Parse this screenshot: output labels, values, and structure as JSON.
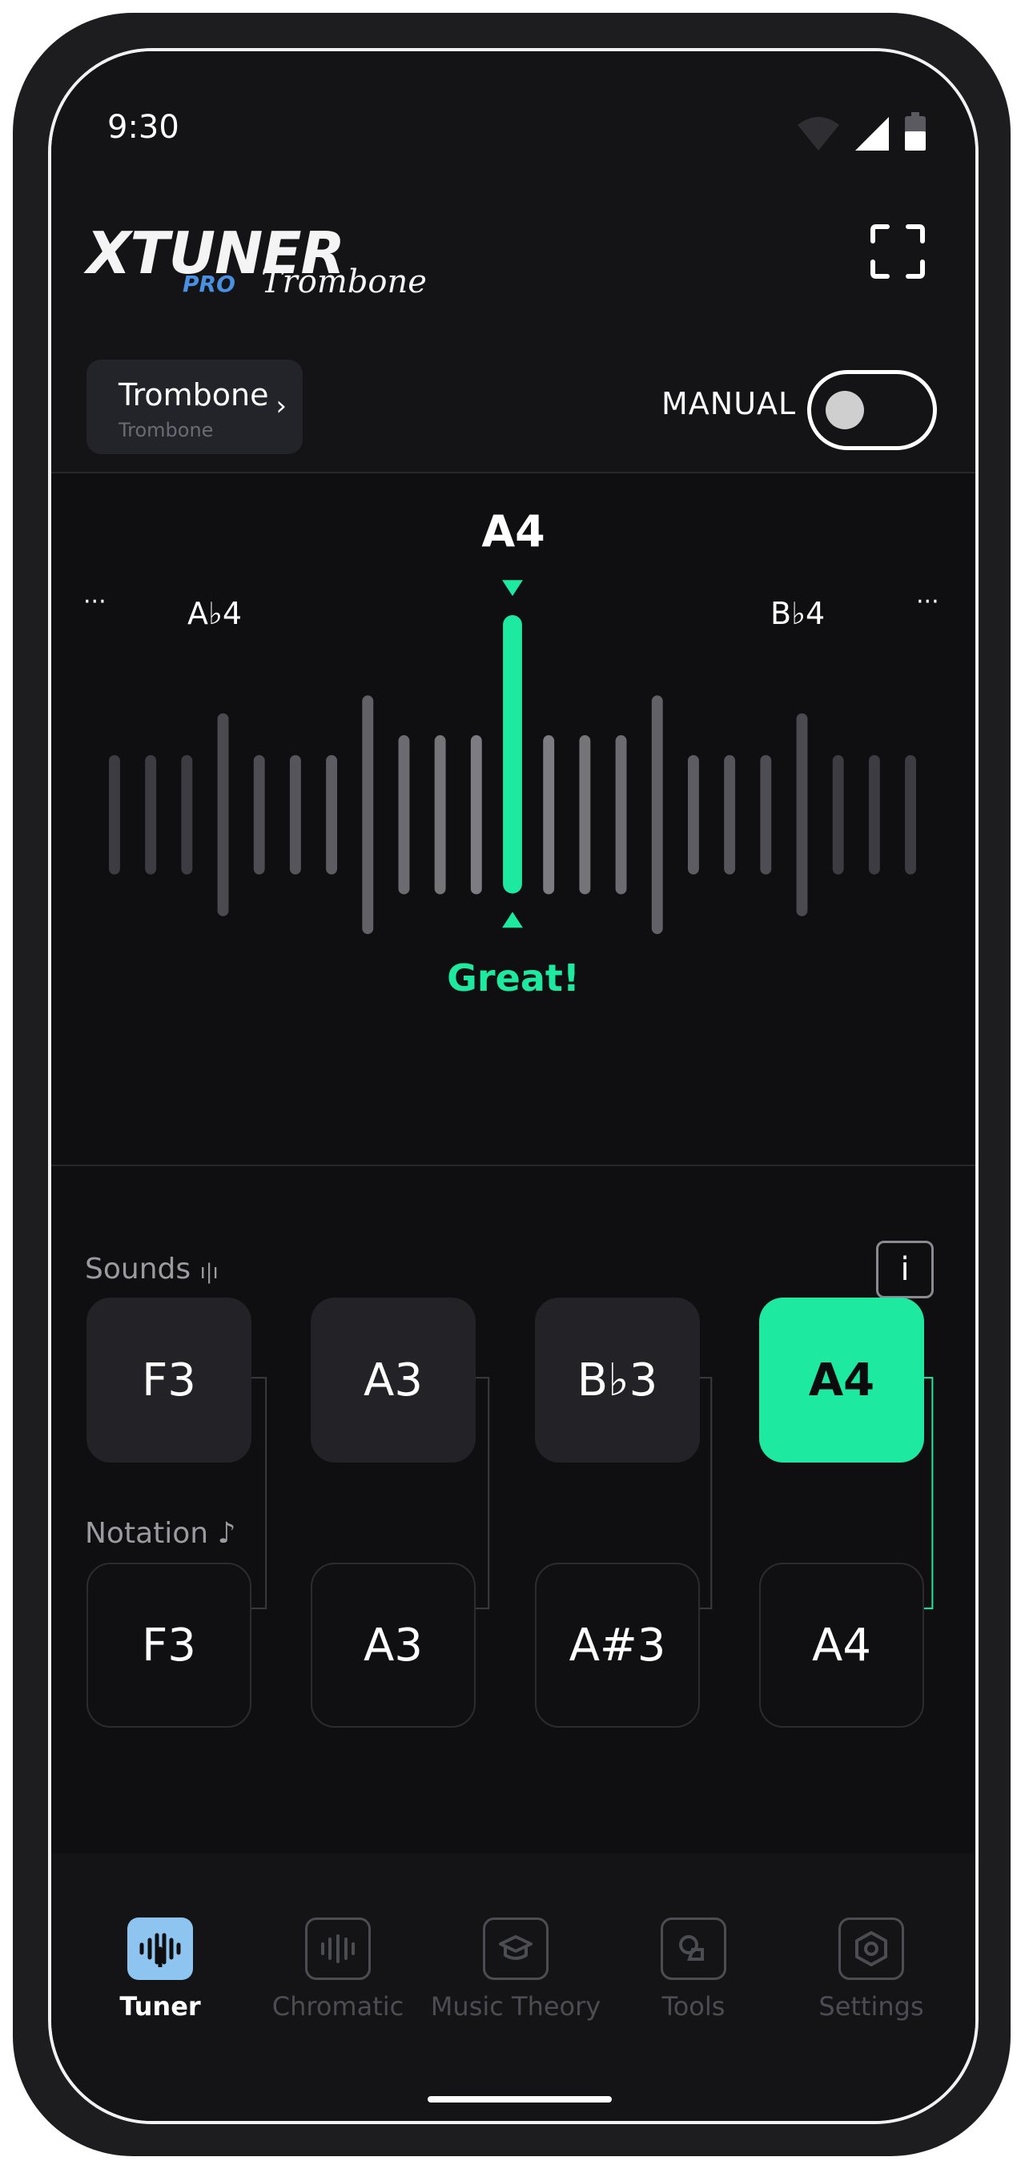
{
  "status_bar": {
    "time": "9:30"
  },
  "logo": {
    "main": "XTUNER",
    "sub": "PRO",
    "script": "Trombone"
  },
  "instrument": {
    "name": "Trombone",
    "sub": "Trombone"
  },
  "mode": {
    "label": "MANUAL",
    "on": false
  },
  "tuner": {
    "target_note": "A4",
    "left_note": "A♭4",
    "right_note": "B♭4",
    "more_left": "···",
    "more_right": "···",
    "status": "Great!",
    "accent": "#1de9a0"
  },
  "info_label": "i",
  "sounds": {
    "label": "Sounds",
    "items": [
      "F3",
      "A3",
      "B♭3",
      "A4"
    ],
    "active_index": 3
  },
  "notation": {
    "label": "Notation",
    "items": [
      "F3",
      "A3",
      "A#3",
      "A4"
    ]
  },
  "nav": {
    "items": [
      {
        "label": "Tuner",
        "icon": "tuner-icon",
        "active": true
      },
      {
        "label": "Chromatic",
        "icon": "chromatic-icon",
        "active": false
      },
      {
        "label": "Music Theory",
        "icon": "music-theory-icon",
        "active": false
      },
      {
        "label": "Tools",
        "icon": "tools-icon",
        "active": false
      },
      {
        "label": "Settings",
        "icon": "settings-icon",
        "active": false
      }
    ]
  }
}
